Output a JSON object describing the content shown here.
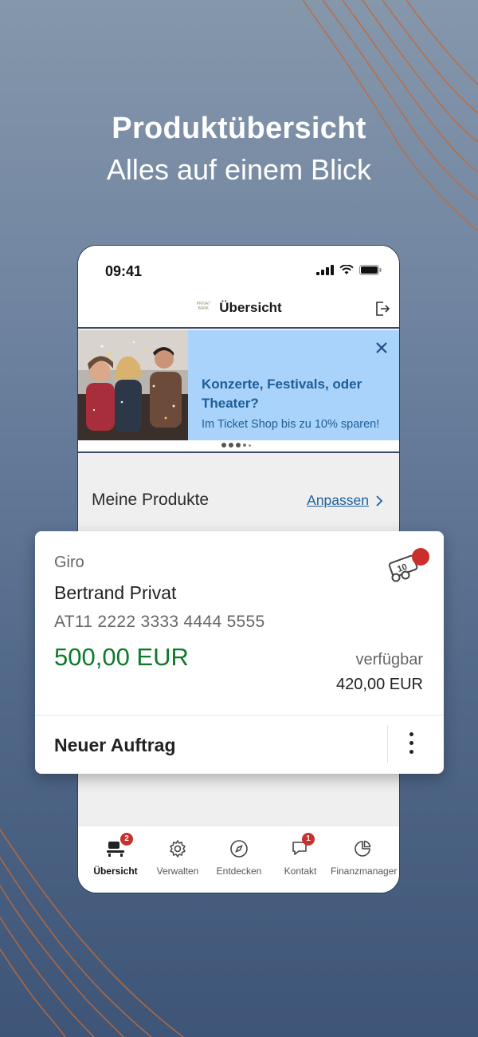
{
  "promo": {
    "title": "Produktübersicht",
    "subtitle": "Alles auf einem Blick"
  },
  "statusbar": {
    "time": "09:41",
    "icons": [
      "signal-icon",
      "wifi-icon",
      "battery-icon"
    ]
  },
  "appbar": {
    "logo_text": "PRIVAT BANK",
    "title": "Übersicht",
    "logout_icon": "logout-icon"
  },
  "banner": {
    "headline": "Konzerte, Festivals, oder Theater?",
    "text": "Im Ticket Shop bis zu 10% sparen!",
    "close_icon": "close-icon",
    "page_count": 5,
    "active_page": 3
  },
  "products": {
    "title": "Meine Produkte",
    "customize_label": "Anpassen"
  },
  "account_card": {
    "type": "Giro",
    "owner": "Bertrand Privat",
    "iban": "AT11 2222 3333 4444 5555",
    "balance": "500,00 EUR",
    "available_label": "verfügbar",
    "available_value": "420,00 EUR",
    "action_label": "Neuer Auftrag",
    "card_icon": "card-reward-icon"
  },
  "bottom_nav": {
    "items": [
      {
        "label": "Übersicht",
        "icon": "overview-icon",
        "badge": "2",
        "active": true
      },
      {
        "label": "Verwalten",
        "icon": "gear-icon",
        "badge": "",
        "active": false
      },
      {
        "label": "Entdecken",
        "icon": "compass-icon",
        "badge": "",
        "active": false
      },
      {
        "label": "Kontakt",
        "icon": "chat-icon",
        "badge": "1",
        "active": false
      },
      {
        "label": "Finanzmanager",
        "icon": "finance-icon",
        "badge": "",
        "active": false
      }
    ]
  },
  "colors": {
    "accent_red": "#c9302c",
    "balance_green": "#0e7a2a",
    "banner_blue": "#a9d3fb",
    "link_blue": "#1f5f9c"
  }
}
